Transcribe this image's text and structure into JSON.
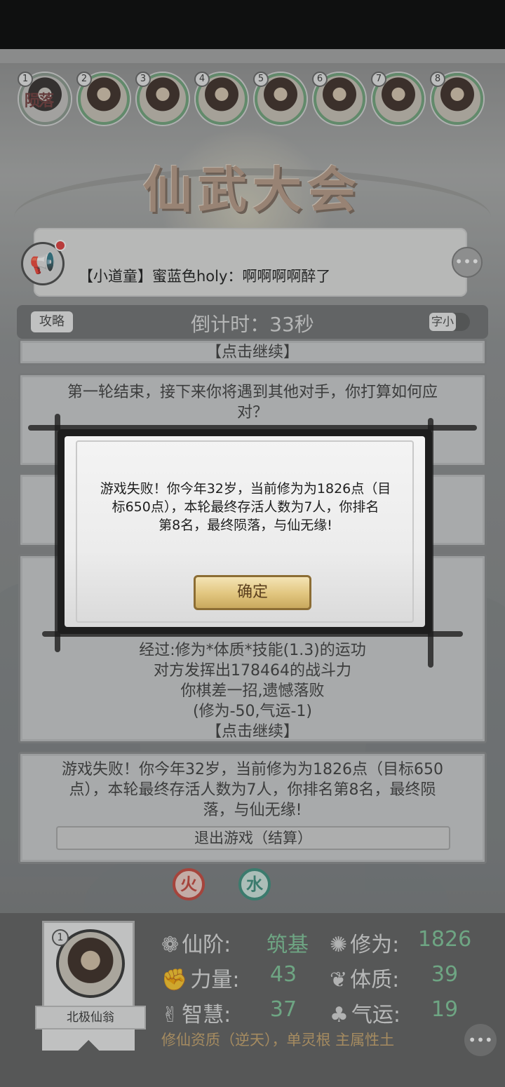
{
  "players": [
    {
      "num": "1",
      "status": "陨落"
    },
    {
      "num": "2",
      "status": ""
    },
    {
      "num": "3",
      "status": ""
    },
    {
      "num": "4",
      "status": ""
    },
    {
      "num": "5",
      "status": ""
    },
    {
      "num": "6",
      "status": ""
    },
    {
      "num": "7",
      "status": ""
    },
    {
      "num": "8",
      "status": ""
    }
  ],
  "title": "仙武大会",
  "broadcast": {
    "text": "【小道童】蜜蓝色holy：啊啊啊啊醉了"
  },
  "header": {
    "guide_label": "攻略",
    "countdown": "倒计时：33秒",
    "font_toggle": "字小"
  },
  "cards": {
    "top_continue": "【点击继续】",
    "round_end": [
      "第一轮结束，接下来你将遇到其他对手，你打算如何应",
      "对？"
    ],
    "battle": [
      "经过:修为*体质*技能(1.3)的运功",
      "对方发挥出178464的战斗力",
      "你棋差一招,遗憾落败",
      "(修为-50,气运-1)",
      "【点击继续】"
    ],
    "result": [
      "游戏失败！你今年32岁，当前修为为1826点（目标650",
      "点），本轮最终存活人数为7人，你排名第8名，最终陨",
      "落，与仙无缘!"
    ],
    "exit_label": "退出游戏（结算）"
  },
  "modal": {
    "lines": [
      "游戏失败！你今年32岁，当前修为为1826点（目",
      "标650点），本轮最终存活人数为7人，你排名",
      "第8名，最终陨落，与仙无缘!"
    ],
    "confirm_label": "确定"
  },
  "elements": {
    "fire": "火",
    "water": "水"
  },
  "player": {
    "num": "1",
    "name": "北极仙翁",
    "stats": {
      "rank_label": "仙阶:",
      "rank_value": "筑基",
      "cultivation_label": "修为:",
      "cultivation_value": "1826",
      "strength_label": "力量:",
      "strength_value": "43",
      "physique_label": "体质:",
      "physique_value": "39",
      "wisdom_label": "智慧:",
      "wisdom_value": "37",
      "luck_label": "气运:",
      "luck_value": "19"
    },
    "aptitude": "修仙资质（逆天），单灵根 主属性土"
  },
  "icons": {
    "horn": "megaphone-icon",
    "chat": "chat-bubble-icon",
    "rank": "lotus-icon",
    "cultivation": "swirl-icon",
    "strength": "fist-icon",
    "physique": "leaf-icon",
    "wisdom": "hand-icon",
    "luck": "clover-icon"
  },
  "colors": {
    "stat_value": "#7fc79a",
    "fallen": "#d81e1e",
    "aptitude": "#c9a56b",
    "fire": "#c9463b",
    "water": "#3b8f7d"
  }
}
